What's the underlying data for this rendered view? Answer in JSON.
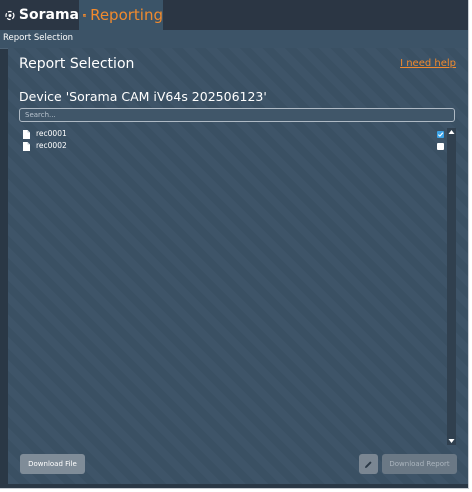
{
  "app": {
    "brand_name": "Sorama",
    "tab_label": "Reporting"
  },
  "breadcrumb": "Report Selection",
  "panel": {
    "title": "Report Selection",
    "help_link": "I need help",
    "device_title": "Device 'Sorama CAM iV64s 202506123'"
  },
  "search": {
    "placeholder": "Search...",
    "value": ""
  },
  "files": [
    {
      "name": "rec0001",
      "checked": true
    },
    {
      "name": "rec0002",
      "checked": false
    }
  ],
  "buttons": {
    "download_file": "Download File",
    "download_report": "Download Report"
  },
  "colors": {
    "accent": "#f08a2e",
    "checkbox_checked": "#3ba2e6",
    "panel_bg": "#3e5468"
  },
  "icons": [
    "sorama-logo-icon",
    "report-icon",
    "file-icon",
    "checkmark-icon",
    "pencil-icon",
    "scroll-up-icon",
    "scroll-down-icon"
  ]
}
